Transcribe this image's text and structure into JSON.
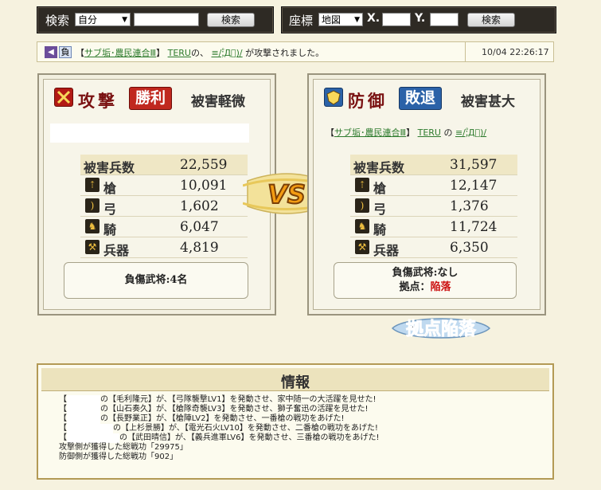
{
  "search": {
    "label": "検索",
    "select": "自分",
    "button": "検索"
  },
  "coord": {
    "label": "座標",
    "select": "地図",
    "x_label": "X.",
    "y_label": "Y.",
    "button": "検索"
  },
  "notice": {
    "tag_neg": "負",
    "pre": "【",
    "alliance": "サブ垢･農民連合Ⅲ",
    "post": "】",
    "user": "TERU",
    "no": "の",
    "comma": "、",
    "target": "≡/;゚Д゚)/",
    "msg": "が攻撃されました。",
    "time": "10/04 22:26:17"
  },
  "attack": {
    "kanji": "攻撃",
    "result": "勝利",
    "damage": "被害軽微",
    "rows": [
      {
        "label": "被害兵数",
        "value": "22,559"
      },
      {
        "label": "槍",
        "value": "10,091"
      },
      {
        "label": "弓",
        "value": "1,602"
      },
      {
        "label": "騎",
        "value": "6,047"
      },
      {
        "label": "兵器",
        "value": "4,819"
      }
    ],
    "injured": "負傷武将:4名"
  },
  "defense": {
    "kanji": "防御",
    "result": "敗退",
    "damage": "被害甚大",
    "alliance_pre": "【",
    "alliance": "サブ垢･農民連合Ⅲ",
    "alliance_post": "】",
    "user": "TERU",
    "no": "の",
    "target": "≡/;゚Д゚)/",
    "rows": [
      {
        "label": "被害兵数",
        "value": "31,597"
      },
      {
        "label": "槍",
        "value": "12,147"
      },
      {
        "label": "弓",
        "value": "1,376"
      },
      {
        "label": "騎",
        "value": "11,724"
      },
      {
        "label": "兵器",
        "value": "6,350"
      }
    ],
    "injured": "負傷武将:なし",
    "base_label": "拠点：",
    "base_value": "陥落"
  },
  "vs_text": "VS",
  "fall_text": "拠点陥落",
  "info": {
    "title": "情報",
    "lines": [
      {
        "pre": "【",
        "post": "の【毛利隆元】が、【弓隊襲撃LV1】を発動させ、家中随一の大活躍を見せた!"
      },
      {
        "pre": "【",
        "post": "の【山石奏久】が、【槍隊奇襲LV3】を発動させ、獅子奮迅の活躍を見せた!"
      },
      {
        "pre": "【",
        "post": "の【長野業正】が、【槍陣LV2】を発動させ、一番槍の戦功をあげた!"
      },
      {
        "pre": "【",
        "post": "の【上杉景勝】が、【電光石火LV10】を発動させ、二番槍の戦功をあげた!"
      },
      {
        "pre": "【",
        "post": "の【武田晴信】が、【義兵進軍LV6】を発動させ、三番槍の戦功をあげた!"
      },
      {
        "pre": "",
        "post": "攻撃側が獲得した総戦功「29975」"
      },
      {
        "pre": "",
        "post": "防御側が獲得した総戦功「902」"
      }
    ]
  },
  "colors": {
    "attack_badge": "#c0281f",
    "defense_badge": "#2b62a8",
    "link": "#2d7b2d",
    "fall": "#c11111"
  }
}
